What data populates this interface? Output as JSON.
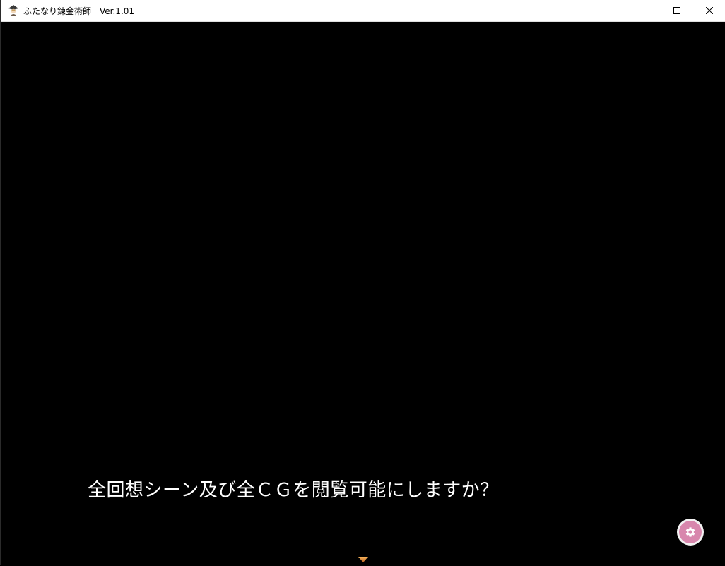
{
  "window": {
    "title": "ふたなり錬金術師　Ver.1.01",
    "icon": "alchemist-app-icon",
    "controls": {
      "minimize": "minimize-icon",
      "maximize": "maximize-icon",
      "close": "close-icon"
    }
  },
  "game": {
    "message": "全回想シーン及び全ＣＧを閲覧可能にしますか？",
    "settings_icon": "gear-icon",
    "next_indicator_icon": "triangle-down-icon",
    "colors": {
      "background": "#000000",
      "message_text": "#ffffff",
      "settings_button": "#d887ad",
      "arrow": "#e0903a"
    }
  }
}
